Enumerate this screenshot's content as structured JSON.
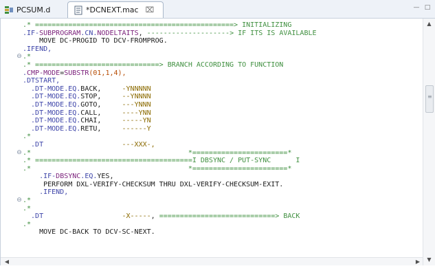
{
  "tabs": [
    {
      "label": "PCSUM.d",
      "icon": "database-icon",
      "active": false
    },
    {
      "label": "*DCNEXT.mac",
      "icon": "file-icon",
      "active": true,
      "close": "⌧"
    }
  ],
  "window_controls": {
    "minimize": "—",
    "maximize": "□"
  },
  "code_lines": [
    {
      "parts": [
        {
          "t": ".* ================================================> INITIALIZING",
          "c": "comment"
        }
      ]
    },
    {
      "parts": [
        {
          "t": ".IF-",
          "c": "dir"
        },
        {
          "t": "SUBPROGRAM",
          "c": "kw"
        },
        {
          "t": ".CN.",
          "c": "dir"
        },
        {
          "t": "NODELTAITS",
          "c": "kw"
        },
        {
          "t": ", ",
          "c": "text"
        },
        {
          "t": "--------------------> IF ITS IS AVAILABLE",
          "c": "comment"
        }
      ]
    },
    {
      "parts": [
        {
          "t": "    MOVE DC-PROGID TO DCV-FROMPROG.",
          "c": "text"
        }
      ]
    },
    {
      "parts": [
        {
          "t": ".IFEND,",
          "c": "dir"
        }
      ]
    },
    {
      "parts": [
        {
          "t": ".*",
          "c": "comment"
        }
      ],
      "fold": true
    },
    {
      "parts": [
        {
          "t": ".* ==============================> BRANCH ACCORDING TO FUNCTION",
          "c": "comment"
        }
      ]
    },
    {
      "parts": [
        {
          "t": ".",
          "c": "dir"
        },
        {
          "t": "CMP-MODE",
          "c": "kw"
        },
        {
          "t": "=",
          "c": "text"
        },
        {
          "t": "SUBSTR",
          "c": "kw"
        },
        {
          "t": "(01,1,4),",
          "c": "num"
        }
      ]
    },
    {
      "parts": [
        {
          "t": ".DTSTART,",
          "c": "dir"
        }
      ]
    },
    {
      "parts": [
        {
          "t": "  .DT-MODE.EQ.",
          "c": "dir"
        },
        {
          "t": "BACK,     ",
          "c": "text"
        },
        {
          "t": "-YNNNNN",
          "c": "val"
        }
      ]
    },
    {
      "parts": [
        {
          "t": "  .DT-MODE.EQ.",
          "c": "dir"
        },
        {
          "t": "STOP,     ",
          "c": "text"
        },
        {
          "t": "--YNNNN",
          "c": "val"
        }
      ]
    },
    {
      "parts": [
        {
          "t": "  .DT-MODE.EQ.",
          "c": "dir"
        },
        {
          "t": "GOTO,     ",
          "c": "text"
        },
        {
          "t": "---YNNN",
          "c": "val"
        }
      ]
    },
    {
      "parts": [
        {
          "t": "  .DT-MODE.EQ.",
          "c": "dir"
        },
        {
          "t": "CALL,     ",
          "c": "text"
        },
        {
          "t": "----YNN",
          "c": "val"
        }
      ]
    },
    {
      "parts": [
        {
          "t": "  .DT-MODE.EQ.",
          "c": "dir"
        },
        {
          "t": "CHAI,     ",
          "c": "text"
        },
        {
          "t": "-----YN",
          "c": "val"
        }
      ]
    },
    {
      "parts": [
        {
          "t": "  .DT-MODE.EQ.",
          "c": "dir"
        },
        {
          "t": "RETU,     ",
          "c": "text"
        },
        {
          "t": "------Y",
          "c": "val"
        }
      ]
    },
    {
      "parts": [
        {
          "t": ".*",
          "c": "comment"
        }
      ]
    },
    {
      "parts": [
        {
          "t": "  .DT                   ",
          "c": "dir"
        },
        {
          "t": "---XXX-,",
          "c": "val"
        }
      ]
    },
    {
      "parts": [
        {
          "t": ".*                                      *=======================*",
          "c": "comment"
        }
      ],
      "fold": true
    },
    {
      "parts": [
        {
          "t": ".* ======================================I DBSYNC / PUT-SYNC      I",
          "c": "comment"
        }
      ]
    },
    {
      "parts": [
        {
          "t": ".*                                      *=======================*",
          "c": "comment"
        }
      ]
    },
    {
      "parts": [
        {
          "t": "    .IF-",
          "c": "dir"
        },
        {
          "t": "DBSYNC",
          "c": "kw"
        },
        {
          "t": ".EQ.",
          "c": "dir"
        },
        {
          "t": "YES,",
          "c": "text"
        }
      ]
    },
    {
      "parts": [
        {
          "t": "     PERFORM DXL-VERIFY-CHECKSUM THRU DXL-VERIFY-CHECKSUM-EXIT.",
          "c": "text"
        }
      ]
    },
    {
      "parts": [
        {
          "t": "    .IFEND,",
          "c": "dir"
        }
      ]
    },
    {
      "parts": [
        {
          "t": ".*",
          "c": "comment"
        }
      ],
      "fold": true
    },
    {
      "parts": [
        {
          "t": ".*",
          "c": "comment"
        }
      ]
    },
    {
      "parts": [
        {
          "t": "  .DT                   ",
          "c": "dir"
        },
        {
          "t": "-X-----",
          "c": "val"
        },
        {
          "t": ", ",
          "c": "text"
        },
        {
          "t": "============================> BACK",
          "c": "comment"
        }
      ]
    },
    {
      "parts": [
        {
          "t": ".*",
          "c": "comment"
        }
      ]
    },
    {
      "parts": [
        {
          "t": "    MOVE DC-BACK TO DCV-SC-NEXT.",
          "c": "text"
        }
      ]
    }
  ],
  "colors": {
    "comment": "#3f8f3f",
    "directive": "#3c43a8",
    "keyword": "#7a1f7a",
    "number": "#b54a00",
    "value": "#8b6a00"
  }
}
